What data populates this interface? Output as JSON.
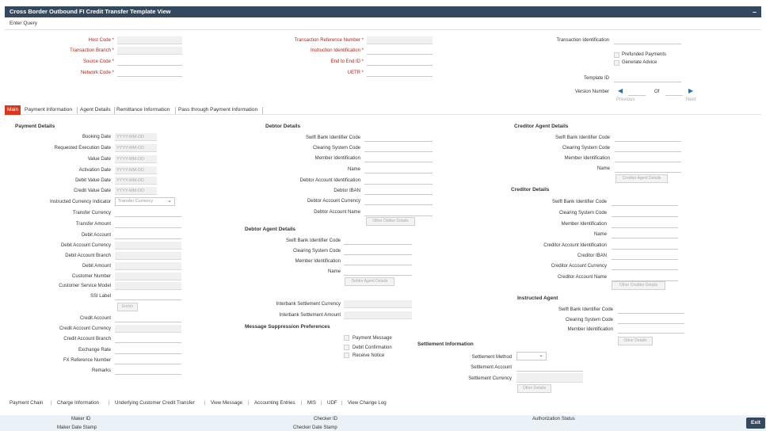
{
  "window": {
    "title": "Cross Border Outbound FI Credit Transfer Template View",
    "minimize": "–"
  },
  "menu": {
    "enter_query": "Enter Query"
  },
  "header": {
    "host_code": "Host Code",
    "txn_branch": "Transaction Branch",
    "source_code": "Source Code",
    "network_code": "Network Code",
    "txn_ref": "Transaction Reference Number",
    "instr_id": "Instruction Identification",
    "e2e_id": "End to End ID",
    "uetr": "UETR",
    "txn_identification": "Transaction Identification",
    "prefunded": "Prefunded Payments",
    "generate_advice": "Generate Advice",
    "template_id": "Template ID",
    "version_number": "Version Number",
    "of": "Of",
    "previous": "Previous",
    "next": "Next",
    "req_mark": "*"
  },
  "tabs": [
    "Main",
    "Payment Information",
    "Agent Details",
    "Remittance Information",
    "Pass through Payment Information"
  ],
  "payment": {
    "title": "Payment Details",
    "date_placeholder": "YYYY-MM-DD",
    "booking": "Booking Date",
    "req_exec": "Requested Execution Date",
    "value": "Value Date",
    "activation": "Activation Date",
    "debit_value": "Debit Value Date",
    "credit_value": "Credit Value Date",
    "instr_ccy_ind": "Instructed Currency Indicator",
    "instr_ccy_val": "Transfer Currency",
    "transfer_ccy": "Transfer Currency",
    "transfer_amt": "Transfer Amount",
    "debit_acct": "Debit Account",
    "debit_acct_ccy": "Debit Account Currency",
    "debit_acct_branch": "Debit Account Branch",
    "debit_amt": "Debit Amount",
    "cust_no": "Customer Number",
    "csm": "Customer Service Model",
    "ssi": "SSI Label",
    "enrich": "Enrich",
    "credit_acct": "Credit Account",
    "credit_acct_ccy": "Credit Account Currency",
    "credit_acct_branch": "Credit Account Branch",
    "exch_rate": "Exchange Rate",
    "fx_ref": "FX Reference Number",
    "remarks": "Remarks"
  },
  "debtor": {
    "title": "Debtor Details",
    "swift": "Swift Bank Identifier Code",
    "clearing": "Clearing System Code",
    "member": "Member Identification",
    "name": "Name",
    "acct_id": "Debtor Account Identification",
    "iban": "Debtor IBAN",
    "acct_ccy": "Debtor Account Currency",
    "acct_name": "Debtor Account Name",
    "other_btn": "Other Debtor Details"
  },
  "debtor_agent": {
    "title": "Debtor Agent Details",
    "swift": "Swift Bank Identifier Code",
    "clearing": "Clearing System Code",
    "member": "Member Identification",
    "name": "Name",
    "btn": "Debtor Agent Details"
  },
  "interbank": {
    "ccy": "Interbank Settlement Currency",
    "amt": "Interbank Settlement Amount"
  },
  "msg_supp": {
    "title": "Message Suppression Preferences",
    "payment_msg": "Payment Message",
    "debit_conf": "Debit Confirmation",
    "receive_notice": "Receive Notice"
  },
  "settlement": {
    "title": "Settlement Information",
    "method": "Settlement Method",
    "account": "Settlement Account",
    "currency": "Settlement Currency",
    "other_btn": "Other Details"
  },
  "creditor_agent": {
    "title": "Creditor Agent Details",
    "swift": "Swift Bank Identifier Code",
    "clearing": "Clearing System Code",
    "member": "Member Identification",
    "name": "Name",
    "btn": "Creditor Agent Details"
  },
  "creditor": {
    "title": "Creditor Details",
    "swift": "Swift Bank Identifier Code",
    "clearing": "Clearing System Code",
    "member": "Member Identification",
    "name": "Name",
    "acct_id": "Creditor Account Identification",
    "iban": "Creditor IBAN",
    "acct_ccy": "Creditor Account Currency",
    "acct_name": "Creditor Account Name",
    "other_btn": "Other Creditor Details"
  },
  "instructed_agent": {
    "title": "Instructed Agent",
    "swift": "Swift Bank Identifier Code",
    "clearing": "Clearing System Code",
    "member": "Member Identification",
    "other_btn": "Other Details"
  },
  "footer_links": [
    "Payment Chain",
    "Charge Information",
    "Underlying Customer Credit Transfer",
    "View Message",
    "Accounting Entries",
    "MIS",
    "UDF",
    "View Change Log"
  ],
  "footer_sep": "|",
  "audit": {
    "maker_id": "Maker ID",
    "maker_date": "Maker Date Stamp",
    "checker_id": "Checker ID",
    "checker_date": "Checker Date Stamp",
    "auth_status": "Authorization Status",
    "exit": "Exit"
  }
}
